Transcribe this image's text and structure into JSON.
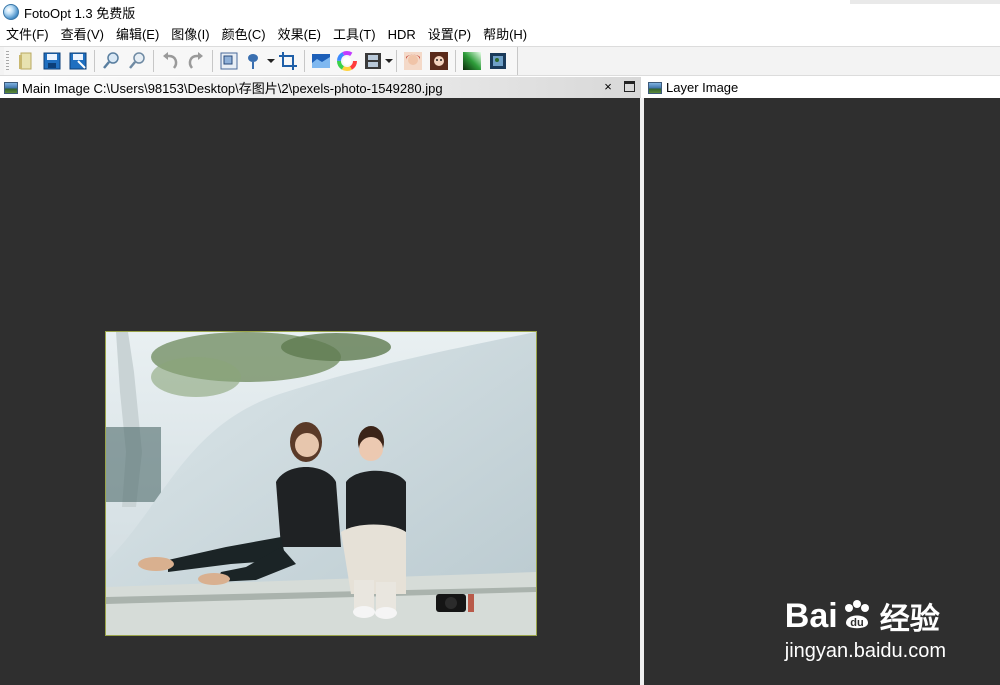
{
  "window": {
    "title": "FotoOpt 1.3 免费版"
  },
  "menu": {
    "items": [
      {
        "label": "文件(F)"
      },
      {
        "label": "查看(V)"
      },
      {
        "label": "编辑(E)"
      },
      {
        "label": "图像(I)"
      },
      {
        "label": "颜色(C)"
      },
      {
        "label": "效果(E)"
      },
      {
        "label": "工具(T)"
      },
      {
        "label": "HDR"
      },
      {
        "label": "设置(P)"
      },
      {
        "label": "帮助(H)"
      }
    ]
  },
  "toolbar": {
    "icons": [
      "open-icon",
      "save-icon",
      "save-as-icon",
      "zoom-in-icon",
      "zoom-out-icon",
      "undo-icon",
      "redo-icon",
      "resize-icon",
      "rotate-icon",
      "crop-icon",
      "levels-icon",
      "color-wheel-icon",
      "filmstrip-icon",
      "portrait-icon",
      "portrait-cartoon-icon",
      "gradient-icon",
      "photo-frame-icon"
    ]
  },
  "main_panel": {
    "title": "Main Image C:\\Users\\98153\\Desktop\\存图片\\2\\pexels-photo-1549280.jpg",
    "close_label": "×",
    "image_alt": "pexels-photo-1549280.jpg"
  },
  "layer_panel": {
    "title": "Layer Image"
  },
  "watermark": {
    "brand": "Bai",
    "brand2": "du",
    "brand_cn": "经验",
    "url": "jingyan.baidu.com"
  },
  "colors": {
    "canvas_bg": "#2f2f2f",
    "photo_border": "#9aa44a",
    "toolbar_bg": "#f3f3f3"
  }
}
